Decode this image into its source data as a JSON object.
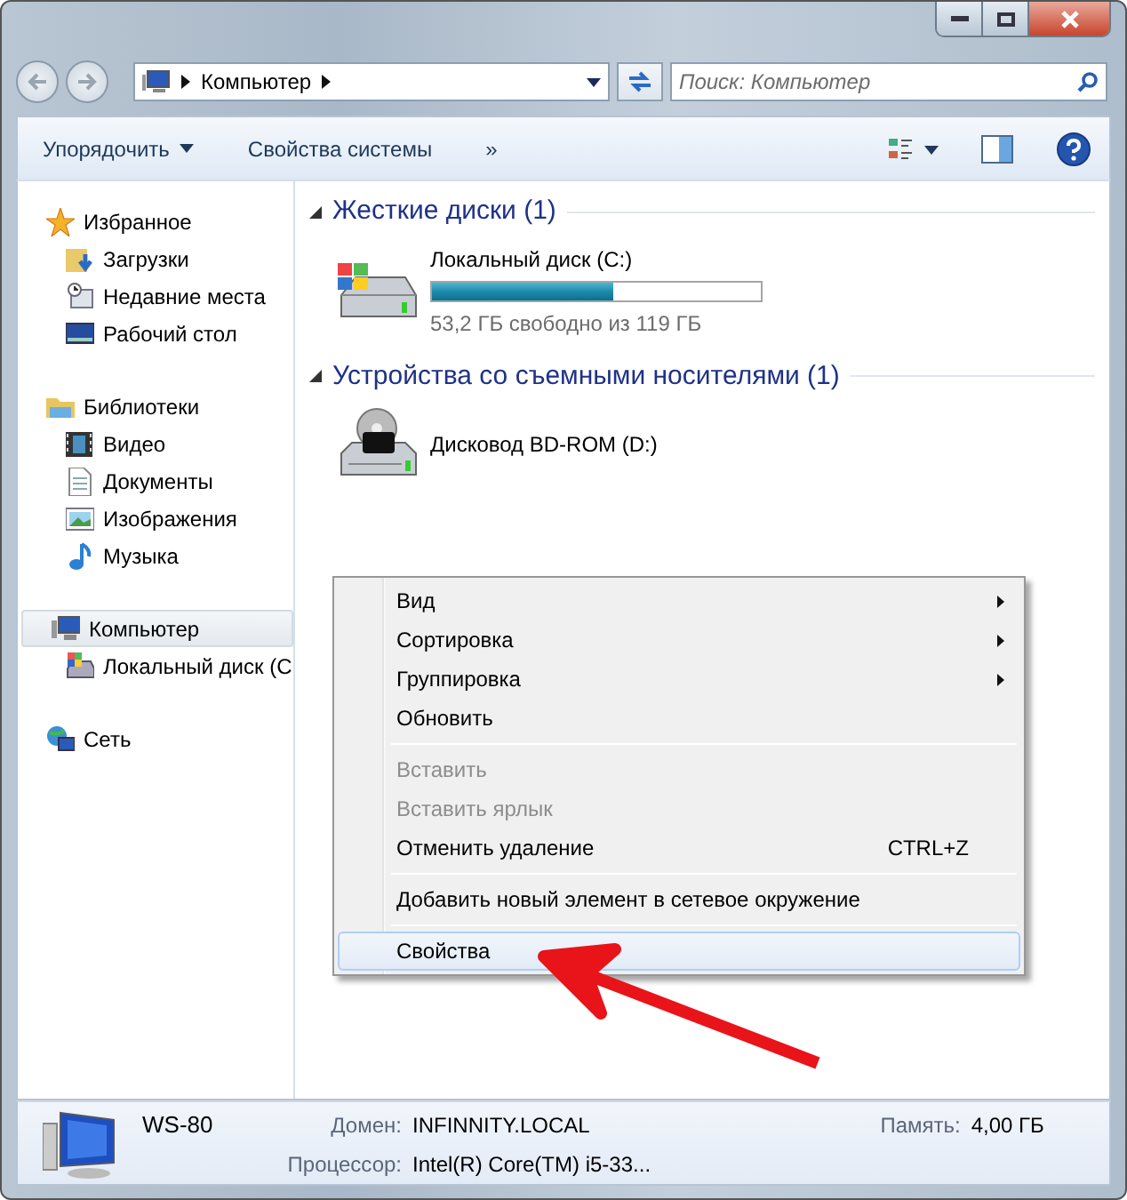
{
  "address": {
    "path": [
      "Компьютер"
    ],
    "search_placeholder": "Поиск: Компьютер"
  },
  "toolbar": [
    {
      "label": "Упорядочить",
      "dropdown": true
    },
    {
      "label": "Свойства системы",
      "dropdown": false
    },
    {
      "label": "»",
      "dropdown": false
    }
  ],
  "sidebar": [
    {
      "label": "Избранное",
      "selected": false,
      "children": [
        {
          "label": "Загрузки",
          "selected": false
        },
        {
          "label": "Недавние места",
          "selected": false
        },
        {
          "label": "Рабочий стол",
          "selected": false
        }
      ]
    },
    {
      "label": "Библиотеки",
      "selected": false,
      "children": [
        {
          "label": "Видео",
          "selected": false
        },
        {
          "label": "Документы",
          "selected": false
        },
        {
          "label": "Изображения",
          "selected": false
        },
        {
          "label": "Музыка",
          "selected": false
        }
      ]
    },
    {
      "label": "Компьютер",
      "selected": true,
      "children": [
        {
          "label": "Локальный диск (C",
          "selected": false
        }
      ]
    },
    {
      "label": "Сеть",
      "selected": false
    }
  ],
  "groups": [
    {
      "title": "Жесткие диски (1)",
      "expanded": true,
      "items": [
        {
          "name": "Локальный диск (C:)",
          "kind": "disk",
          "level": 0.55,
          "info": "53,2 ГБ свободно из 119 ГБ"
        }
      ]
    },
    {
      "title": "Устройства со съемными носителями (1)",
      "expanded": true,
      "items": [
        {
          "name": "Дисковод BD-ROM (D:)",
          "kind": "optical"
        }
      ]
    }
  ],
  "context_menu": [
    {
      "kind": "item",
      "label": "Вид",
      "submenu": true,
      "disabled": false,
      "selected": false
    },
    {
      "kind": "item",
      "label": "Сортировка",
      "submenu": true,
      "disabled": false,
      "selected": false
    },
    {
      "kind": "item",
      "label": "Группировка",
      "submenu": true,
      "disabled": false,
      "selected": false
    },
    {
      "kind": "item",
      "label": "Обновить",
      "submenu": false,
      "disabled": false,
      "selected": false
    },
    {
      "kind": "separator"
    },
    {
      "kind": "item",
      "label": "Вставить",
      "submenu": false,
      "disabled": true,
      "selected": false
    },
    {
      "kind": "item",
      "label": "Вставить ярлык",
      "submenu": false,
      "disabled": true,
      "selected": false
    },
    {
      "kind": "item",
      "label": "Отменить удаление",
      "shortcut": "CTRL+Z",
      "submenu": false,
      "disabled": false,
      "selected": false
    },
    {
      "kind": "separator"
    },
    {
      "kind": "item",
      "label": "Добавить новый элемент в сетевое окружение",
      "submenu": false,
      "disabled": false,
      "selected": false
    },
    {
      "kind": "separator"
    },
    {
      "kind": "item",
      "label": "Свойства",
      "submenu": false,
      "disabled": false,
      "selected": true
    }
  ],
  "details": {
    "name": "WS-80",
    "fields": [
      {
        "label": "Домен:",
        "value": "INFINNITY.LOCAL"
      },
      {
        "label": "Память:",
        "value": "4,00 ГБ"
      },
      {
        "label": "Процессор:",
        "value": "Intel(R) Core(TM) i5-33..."
      }
    ]
  }
}
